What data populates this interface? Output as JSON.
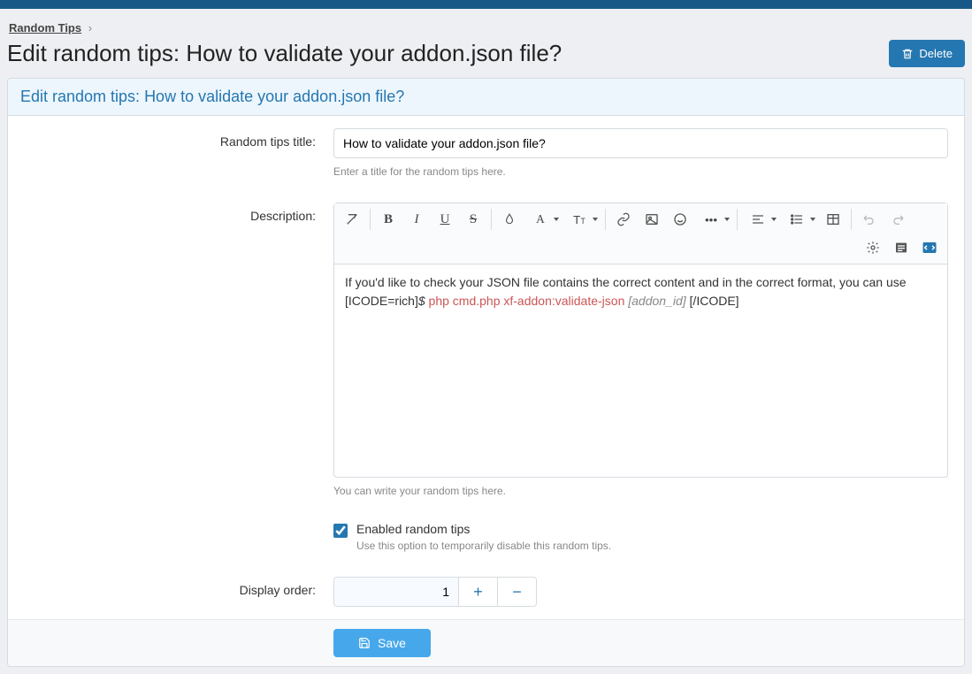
{
  "breadcrumb": {
    "root": "Random Tips"
  },
  "header": {
    "title": "Edit random tips: How to validate your addon.json file?",
    "delete_label": "Delete"
  },
  "panel": {
    "title": "Edit random tips: How to validate your addon.json file?"
  },
  "fields": {
    "title_label": "Random tips title:",
    "title_value": "How to validate your addon.json file?",
    "title_help": "Enter a title for the random tips here.",
    "desc_label": "Description:",
    "desc_help": "You can write your random tips here.",
    "enabled_label": "Enabled random tips",
    "enabled_help": "Use this option to temporarily disable this random tips.",
    "order_label": "Display order:",
    "order_value": "1"
  },
  "editor_content": {
    "pre": "If you'd like to check your JSON file contains the correct content and in the correct format, you can use [ICODE=rich]",
    "dollar": "$",
    "cmd": " php cmd.php xf-addon:validate-json ",
    "arg": "[addon_id]",
    "post": " [/ICODE]"
  },
  "buttons": {
    "save": "Save",
    "plus": "+",
    "minus": "−"
  }
}
